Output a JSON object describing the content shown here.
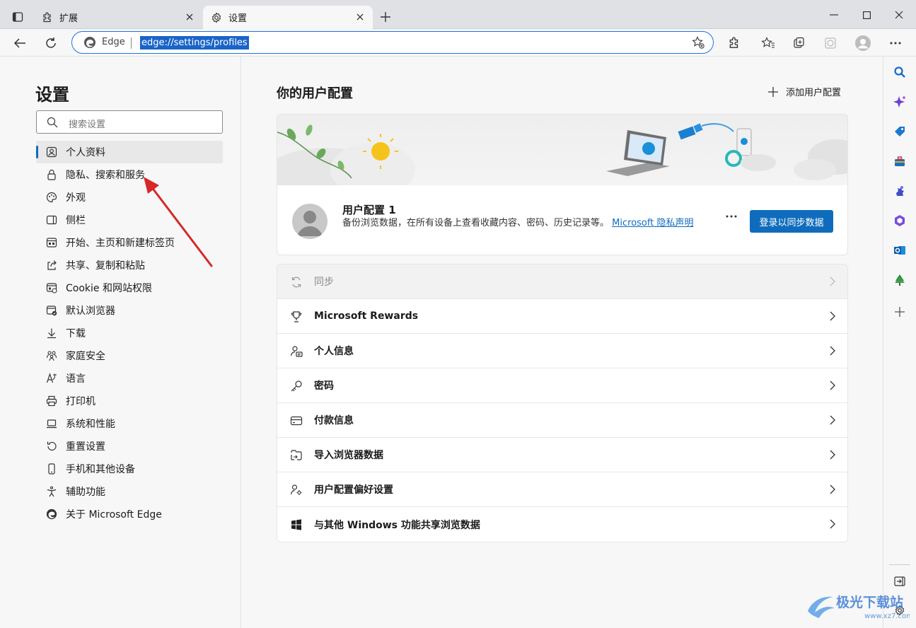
{
  "tabs": [
    {
      "label": "扩展",
      "icon": "puzzle-icon"
    },
    {
      "label": "设置",
      "icon": "gear-icon"
    }
  ],
  "address": {
    "site_label": "Edge",
    "url": "edge://settings/profiles"
  },
  "sidebar": {
    "title": "设置",
    "search_placeholder": "搜索设置",
    "items": [
      {
        "label": "个人资料",
        "icon": "profile-icon",
        "active": true
      },
      {
        "label": "隐私、搜索和服务",
        "icon": "lock-icon"
      },
      {
        "label": "外观",
        "icon": "palette-icon"
      },
      {
        "label": "侧栏",
        "icon": "sidebar-icon"
      },
      {
        "label": "开始、主页和新建标签页",
        "icon": "home-tab-icon"
      },
      {
        "label": "共享、复制和粘贴",
        "icon": "share-icon"
      },
      {
        "label": "Cookie 和网站权限",
        "icon": "cookie-icon"
      },
      {
        "label": "默认浏览器",
        "icon": "default-browser-icon"
      },
      {
        "label": "下载",
        "icon": "download-icon"
      },
      {
        "label": "家庭安全",
        "icon": "family-icon"
      },
      {
        "label": "语言",
        "icon": "language-icon"
      },
      {
        "label": "打印机",
        "icon": "printer-icon"
      },
      {
        "label": "系统和性能",
        "icon": "laptop-icon"
      },
      {
        "label": "重置设置",
        "icon": "reset-icon"
      },
      {
        "label": "手机和其他设备",
        "icon": "phone-icon"
      },
      {
        "label": "辅助功能",
        "icon": "accessibility-icon"
      },
      {
        "label": "关于 Microsoft Edge",
        "icon": "edge-logo-icon"
      }
    ]
  },
  "main": {
    "title": "你的用户配置",
    "add_profile": "添加用户配置",
    "profile": {
      "name": "用户配置 1",
      "description": "备份浏览数据，在所有设备上查看收藏内容、密码、历史记录等。",
      "privacy_link": "Microsoft 隐私声明",
      "sync_button": "登录以同步数据"
    },
    "rows": [
      {
        "label": "同步",
        "icon": "sync-icon",
        "disabled": true
      },
      {
        "label": "Microsoft Rewards",
        "icon": "trophy-icon"
      },
      {
        "label": "个人信息",
        "icon": "person-card-icon"
      },
      {
        "label": "密码",
        "icon": "key-icon"
      },
      {
        "label": "付款信息",
        "icon": "credit-card-icon"
      },
      {
        "label": "导入浏览器数据",
        "icon": "import-icon"
      },
      {
        "label": "用户配置偏好设置",
        "icon": "profile-settings-icon"
      },
      {
        "label": "与其他 Windows 功能共享浏览数据",
        "icon": "windows-icon"
      }
    ]
  },
  "watermark": "极光下载站",
  "colors": {
    "accent": "#0f6cbd",
    "annotation_arrow": "#d62828"
  }
}
